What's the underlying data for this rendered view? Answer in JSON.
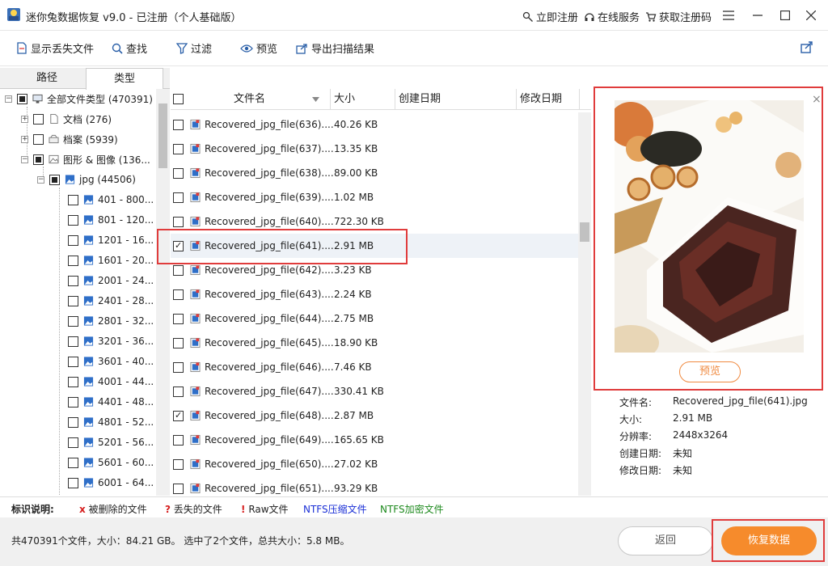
{
  "titlebar": {
    "title": "迷你兔数据恢复 v9.0 - 已注册（个人基础版）",
    "register_now": "立即注册",
    "online_service": "在线服务",
    "get_code": "获取注册码"
  },
  "toolbar": {
    "show_lost": "显示丢失文件",
    "find": "查找",
    "filter": "过滤",
    "preview": "预览",
    "export": "导出扫描结果"
  },
  "tabs": {
    "path": "路径",
    "type": "类型"
  },
  "tree": [
    {
      "label": "全部文件类型 (470391)"
    },
    {
      "label": "文档 (276)"
    },
    {
      "label": "档案 (5939)"
    },
    {
      "label": "图形 & 图像 (136..."
    },
    {
      "label": "jpg (44506)"
    },
    {
      "label": "401 - 800..."
    },
    {
      "label": "801 - 120..."
    },
    {
      "label": "1201 - 16..."
    },
    {
      "label": "1601 - 20..."
    },
    {
      "label": "2001 - 24..."
    },
    {
      "label": "2401 - 28..."
    },
    {
      "label": "2801 - 32..."
    },
    {
      "label": "3201 - 36..."
    },
    {
      "label": "3601 - 40..."
    },
    {
      "label": "4001 - 44..."
    },
    {
      "label": "4401 - 48..."
    },
    {
      "label": "4801 - 52..."
    },
    {
      "label": "5201 - 56..."
    },
    {
      "label": "5601 - 60..."
    },
    {
      "label": "6001 - 64..."
    }
  ],
  "list": {
    "headers": {
      "name": "文件名",
      "size": "大小",
      "created": "创建日期",
      "modified": "修改日期"
    },
    "rows": [
      {
        "name": "Recovered_jpg_file(636)....",
        "size": "40.26 KB",
        "checked": false
      },
      {
        "name": "Recovered_jpg_file(637)....",
        "size": "13.35 KB",
        "checked": false
      },
      {
        "name": "Recovered_jpg_file(638)....",
        "size": "89.00 KB",
        "checked": false
      },
      {
        "name": "Recovered_jpg_file(639)....",
        "size": "1.02 MB",
        "checked": false
      },
      {
        "name": "Recovered_jpg_file(640)....",
        "size": "722.30 KB",
        "checked": false
      },
      {
        "name": "Recovered_jpg_file(641)....",
        "size": "2.91 MB",
        "checked": true
      },
      {
        "name": "Recovered_jpg_file(642)....",
        "size": "3.23 KB",
        "checked": false
      },
      {
        "name": "Recovered_jpg_file(643)....",
        "size": "2.24 KB",
        "checked": false
      },
      {
        "name": "Recovered_jpg_file(644)....",
        "size": "2.75 MB",
        "checked": false
      },
      {
        "name": "Recovered_jpg_file(645)....",
        "size": "18.90 KB",
        "checked": false
      },
      {
        "name": "Recovered_jpg_file(646)....",
        "size": "7.46 KB",
        "checked": false
      },
      {
        "name": "Recovered_jpg_file(647)....",
        "size": "330.41 KB",
        "checked": false
      },
      {
        "name": "Recovered_jpg_file(648)....",
        "size": "2.87 MB",
        "checked": true
      },
      {
        "name": "Recovered_jpg_file(649)....",
        "size": "165.65 KB",
        "checked": false
      },
      {
        "name": "Recovered_jpg_file(650)....",
        "size": "27.02 KB",
        "checked": false
      },
      {
        "name": "Recovered_jpg_file(651)....",
        "size": "93.29 KB",
        "checked": false
      }
    ]
  },
  "preview": {
    "button": "预览",
    "info": [
      {
        "key": "文件名:",
        "value": "Recovered_jpg_file(641).jpg"
      },
      {
        "key": "大小:",
        "value": "2.91 MB"
      },
      {
        "key": "分辨率:",
        "value": "2448x3264"
      },
      {
        "key": "创建日期:",
        "value": "未知"
      },
      {
        "key": "修改日期:",
        "value": "未知"
      }
    ]
  },
  "legend": {
    "title": "标识说明:",
    "deleted_mark": "x",
    "deleted": "被删除的文件",
    "lost_mark": "?",
    "lost": "丢失的文件",
    "raw_mark": "!",
    "raw": "Raw文件",
    "ntfs_compressed": "NTFS压缩文件",
    "ntfs_encrypted": "NTFS加密文件"
  },
  "status": {
    "summary": "共470391个文件，大小：84.21 GB。 选中了2个文件，总共大小：5.8 MB。",
    "back": "返回",
    "recover": "恢复数据"
  },
  "colors": {
    "accent": "#f68b2c",
    "highlight": "#e03c3c",
    "legend_deleted": "#d62020",
    "legend_ntfs_compressed": "#1a2fd6",
    "legend_ntfs_encrypted": "#1e8a1e"
  }
}
